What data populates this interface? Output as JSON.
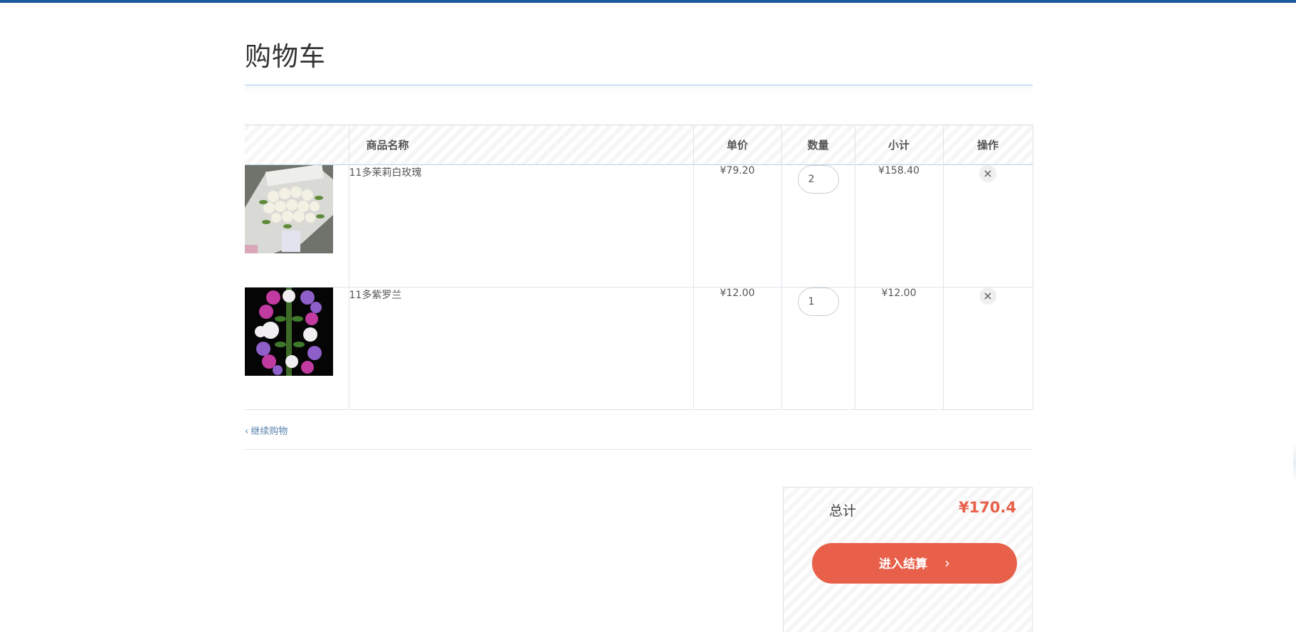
{
  "page": {
    "title": "购物车"
  },
  "table": {
    "headers": {
      "name": "商品名称",
      "price": "单价",
      "qty": "数量",
      "subtotal": "小计",
      "op": "操作"
    },
    "rows": [
      {
        "name": "11多茉莉白玫瑰",
        "price": "¥79.20",
        "qty": "2",
        "subtotal": "¥158.40",
        "image_icon": "white-rose-bouquet-image",
        "remove": "×"
      },
      {
        "name": "11多紫罗兰",
        "price": "¥12.00",
        "qty": "1",
        "subtotal": "¥12.00",
        "image_icon": "purple-violet-bouquet-image",
        "remove": "×"
      }
    ]
  },
  "continue_shopping": {
    "chevron": "‹",
    "label": "继续购物"
  },
  "summary": {
    "label": "总计",
    "total": "¥170.4",
    "checkout_label": "进入结算",
    "checkout_arrow": "›"
  },
  "colors": {
    "top_bar": "#1d5a9c",
    "accent": "#e8604a",
    "link": "#5a82ad"
  }
}
